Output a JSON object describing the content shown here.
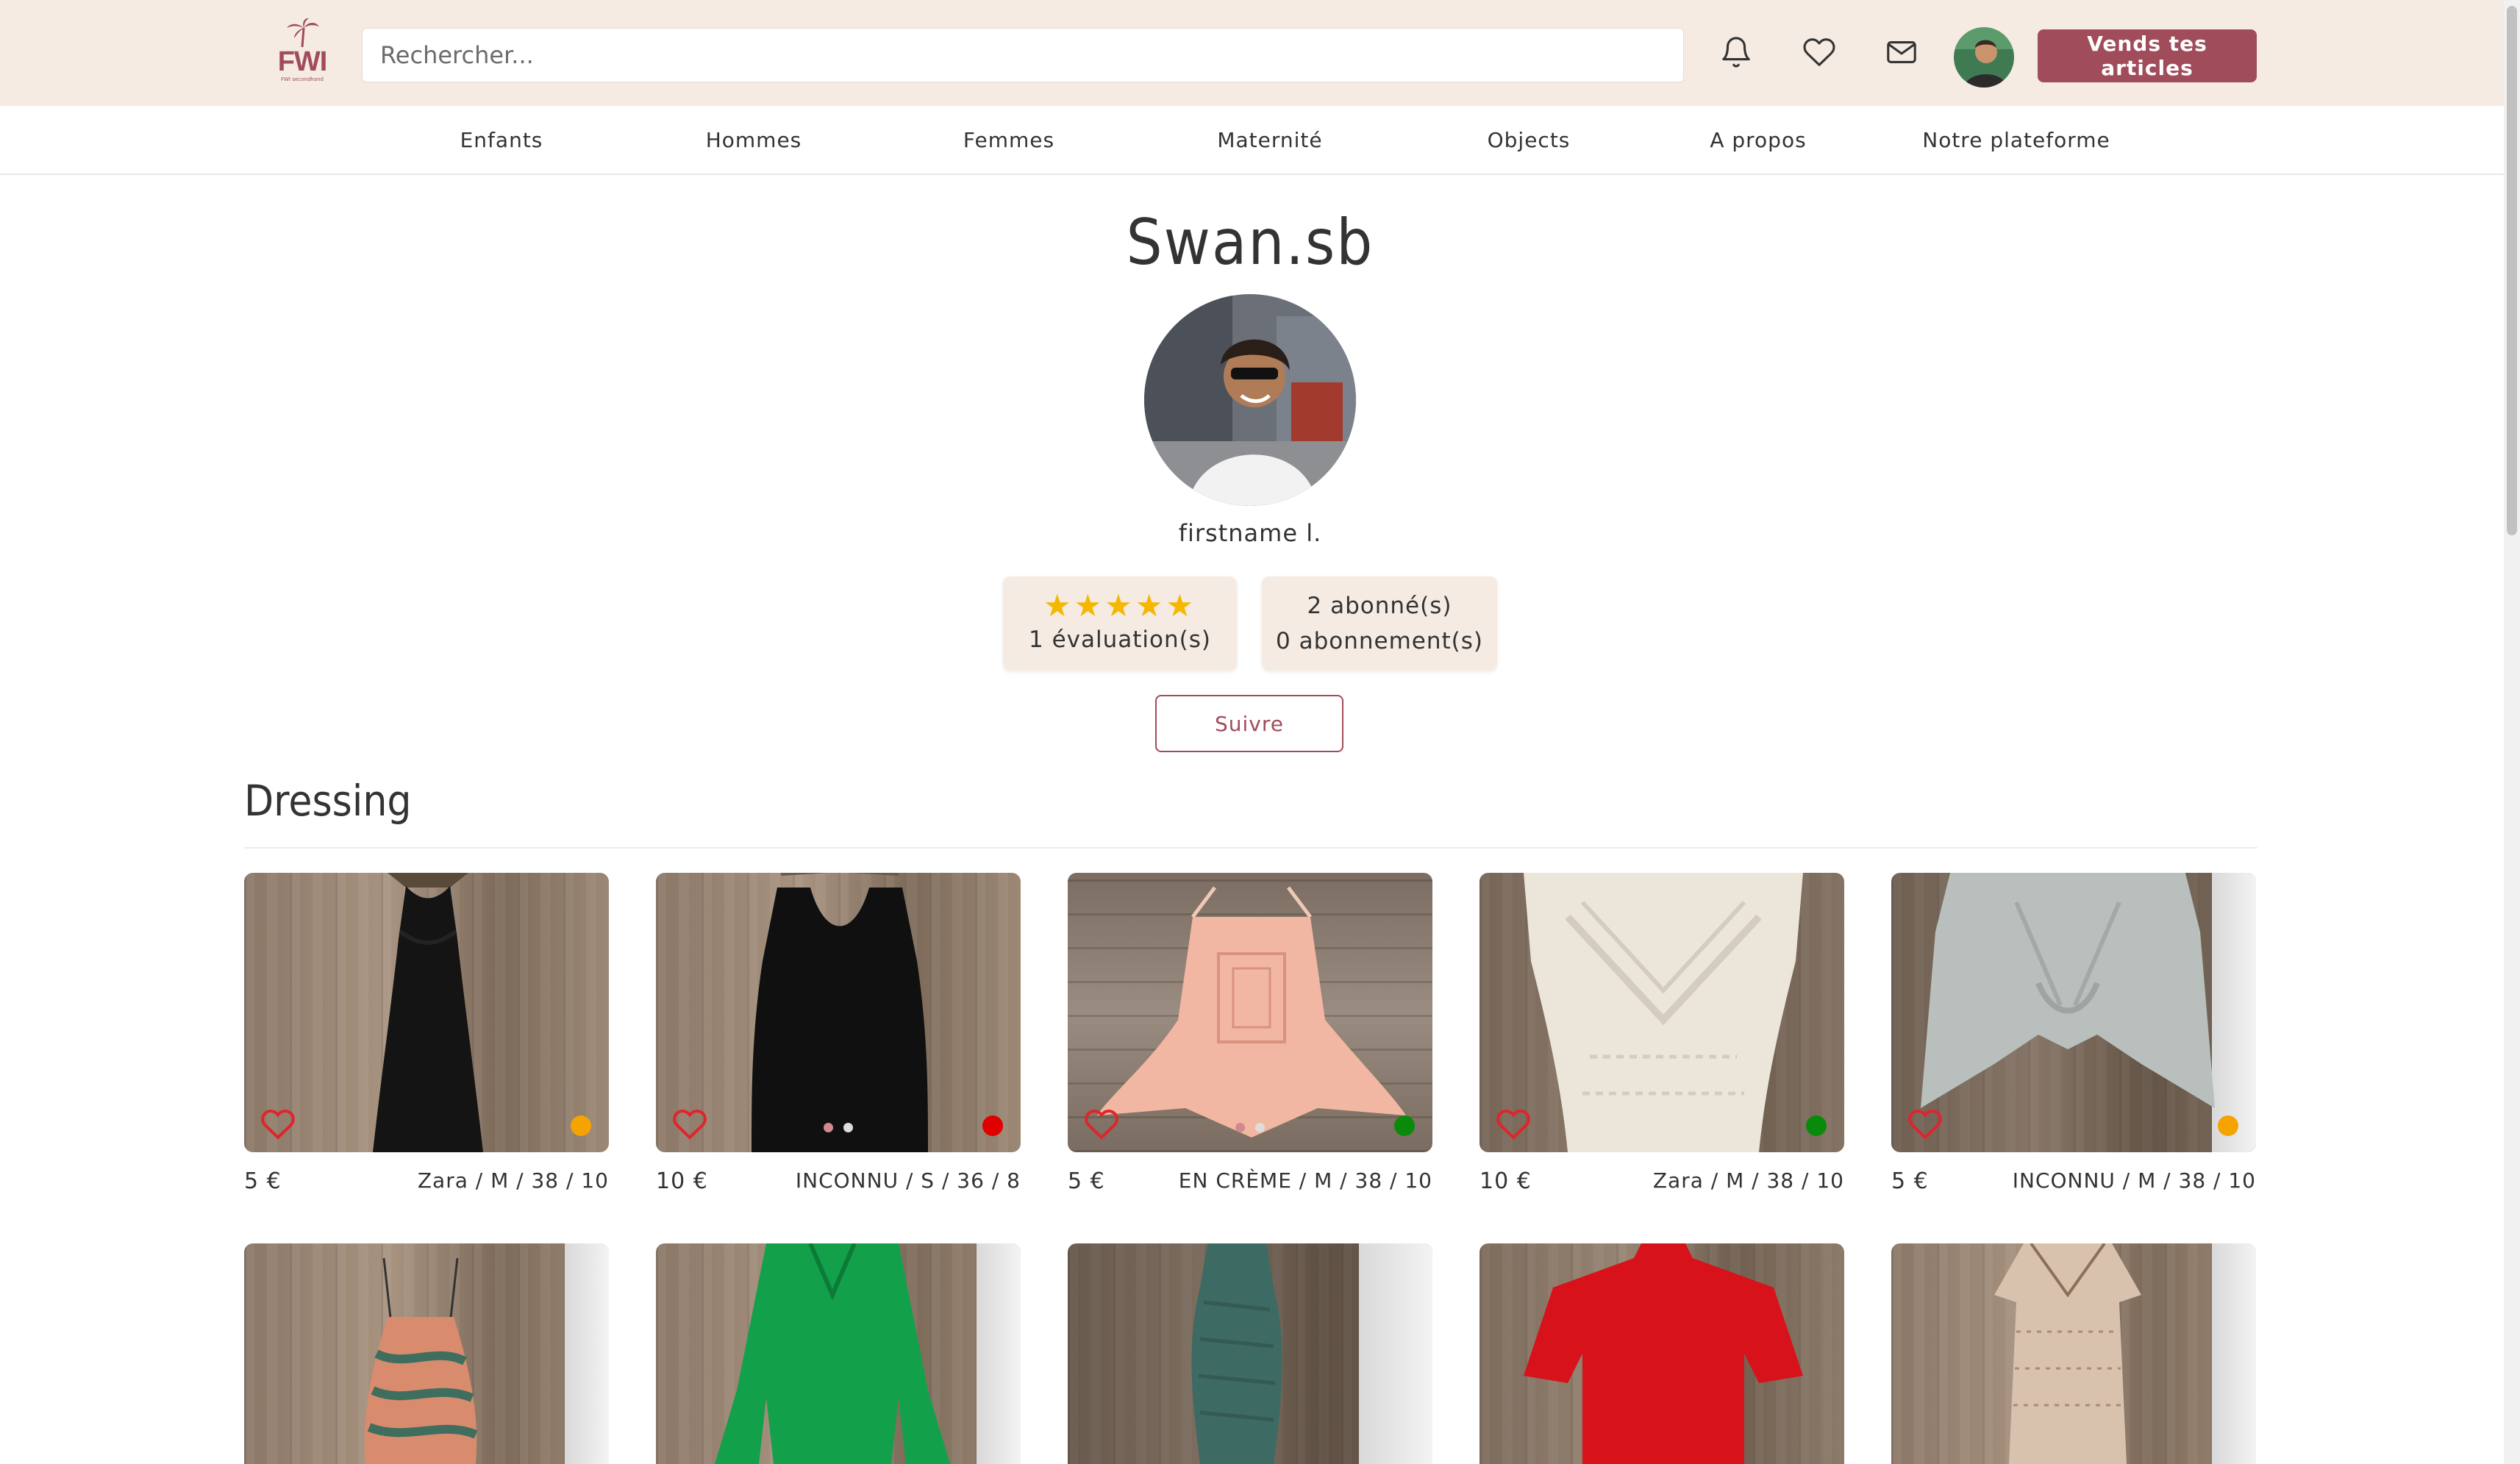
{
  "header": {
    "logo_text": "FWI",
    "logo_sub": "FWI secondhand",
    "search_placeholder": "Rechercher...",
    "icons": [
      "bell-icon",
      "heart-icon",
      "mail-icon"
    ],
    "sell_label": "Vends tes articles"
  },
  "nav": [
    {
      "label": "Enfants"
    },
    {
      "label": "Hommes"
    },
    {
      "label": "Femmes"
    },
    {
      "label": "Maternité"
    },
    {
      "label": "Objects"
    },
    {
      "label": "A propos"
    },
    {
      "label": "Notre plateforme"
    }
  ],
  "profile": {
    "username": "Swan.sb",
    "realname": "firstname l.",
    "rating_stars": 5,
    "stars_text": "★★★★★",
    "evaluations": "1 évaluation(s)",
    "followers": "2 abonné(s)",
    "following": "0 abonnement(s)",
    "follow_label": "Suivre"
  },
  "dressing": {
    "title": "Dressing",
    "items": [
      {
        "price": "5 €",
        "details": "Zara / M / 38 / 10",
        "status_color": "#f5a300"
      },
      {
        "price": "10 €",
        "details": "INCONNU / S / 36 / 8",
        "status_color": "#e00000"
      },
      {
        "price": "5 €",
        "details": "EN CRÈME / M / 38 / 10",
        "status_color": "#0a8a0a"
      },
      {
        "price": "10 €",
        "details": "Zara / M / 38 / 10",
        "status_color": "#0a8a0a"
      },
      {
        "price": "5 €",
        "details": "INCONNU / M / 38 / 10",
        "status_color": "#f5a300"
      }
    ]
  },
  "colors": {
    "brand": "#a14c5a",
    "header_bg": "#f5ebe3",
    "star": "#f5b700"
  }
}
